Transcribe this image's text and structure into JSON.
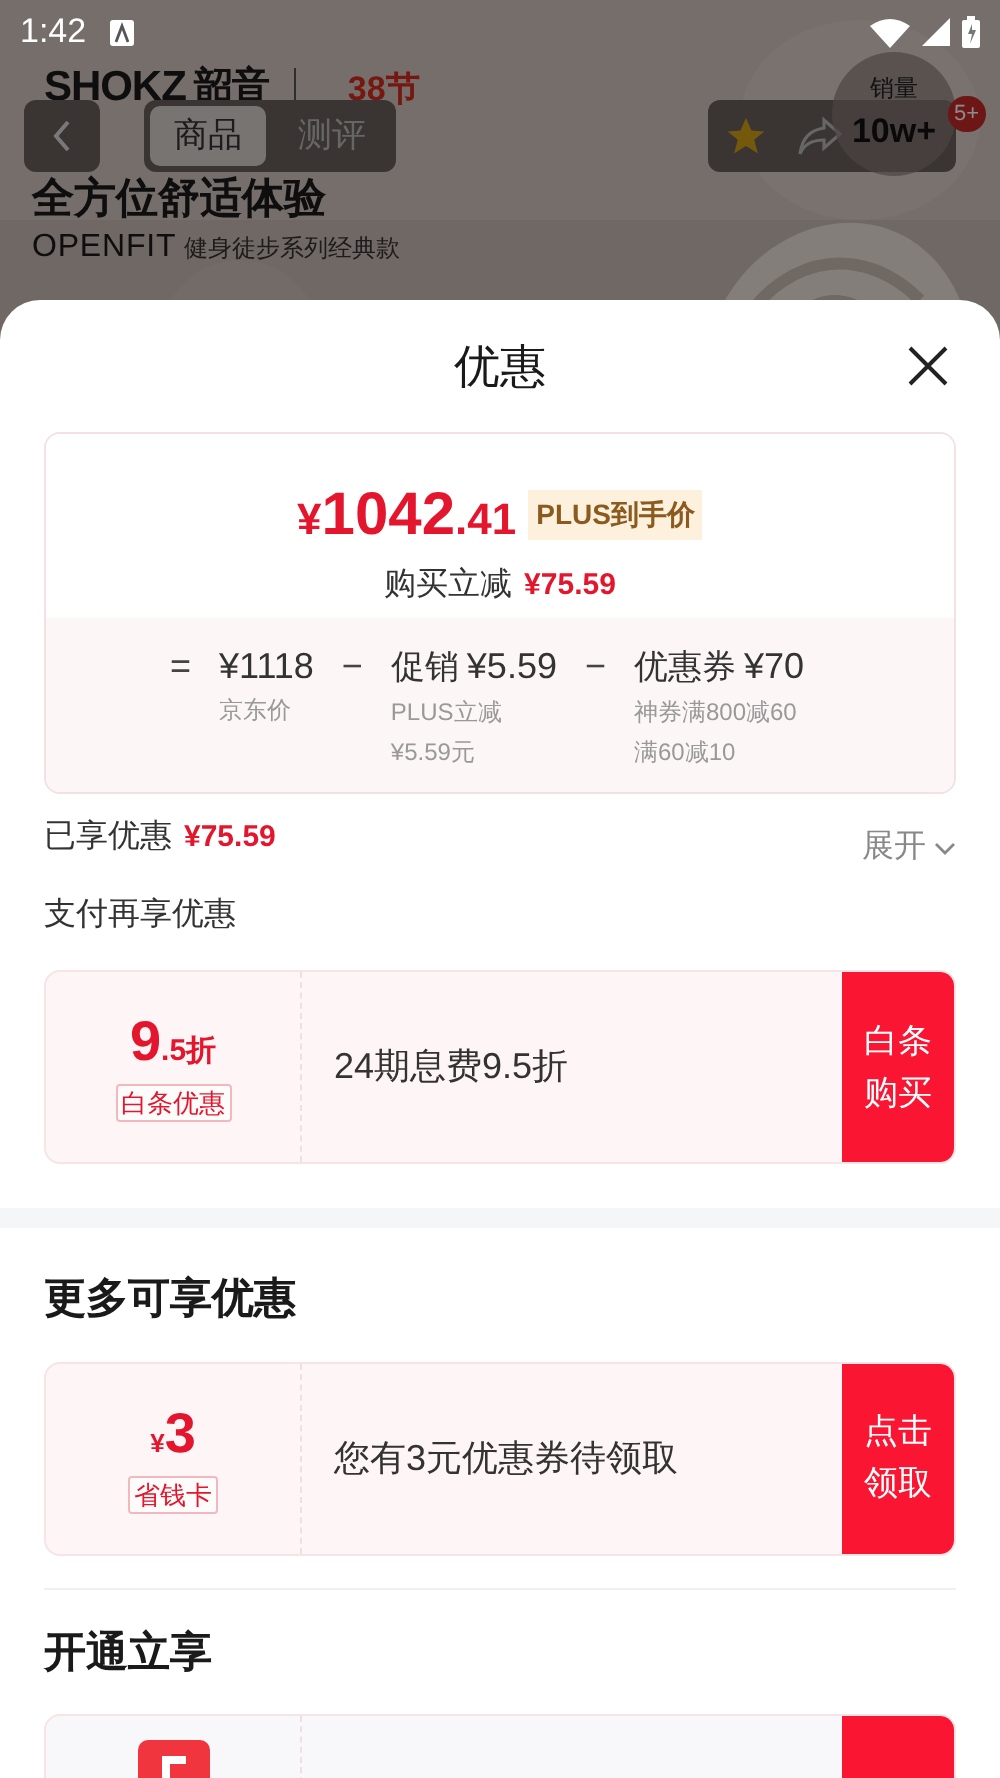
{
  "status_bar": {
    "time": "1:42"
  },
  "background_page": {
    "brand": "SHOKZ",
    "brand_cn": "韶音",
    "event": "38节",
    "tabs": [
      {
        "label": "商品",
        "selected": true
      },
      {
        "label": "测评",
        "selected": false
      }
    ],
    "headline": "全方位舒适体验",
    "subhead_brand": "OPENFIT",
    "subhead": "健身徒步系列经典款",
    "sales_label": "销量",
    "sales_value": "10w+",
    "badge": "5+"
  },
  "sheet": {
    "title": "优惠",
    "price": {
      "currency": "¥",
      "integer": "1042",
      "decimal": ".41",
      "tag": "PLUS到手价",
      "reduce_label": "购买立减",
      "reduce_value": "¥75.59"
    },
    "breakdown": [
      {
        "op": "=",
        "amount": "¥1118",
        "notes": [
          "京东价"
        ]
      },
      {
        "op": "−",
        "title": "促销",
        "amount": "¥5.59",
        "notes": [
          "PLUS立减",
          "¥5.59元"
        ]
      },
      {
        "op": "−",
        "title": "优惠券",
        "amount": "¥70",
        "notes": [
          "神券满800减60",
          "满60减10"
        ]
      }
    ],
    "enjoyed": {
      "label": "已享优惠",
      "value": "¥75.59",
      "toggle": "展开"
    },
    "sections": [
      {
        "title": "支付再享优惠",
        "kind": "inline",
        "offers": [
          {
            "kind": "discount",
            "big": "9",
            "small": ".5折",
            "tag": "白条优惠",
            "text": "24期息费9.5折",
            "action": "白条购买"
          }
        ]
      },
      {
        "title": "更多可享优惠",
        "kind": "banded",
        "offers": [
          {
            "kind": "cash",
            "prefix": "¥",
            "big": "3",
            "tag": "省钱卡",
            "text": "您有3元优惠券待领取",
            "action": "点击领取"
          }
        ]
      },
      {
        "title": "开通立享",
        "kind": "ruled",
        "offers": [
          {
            "kind": "logo"
          }
        ]
      }
    ]
  }
}
